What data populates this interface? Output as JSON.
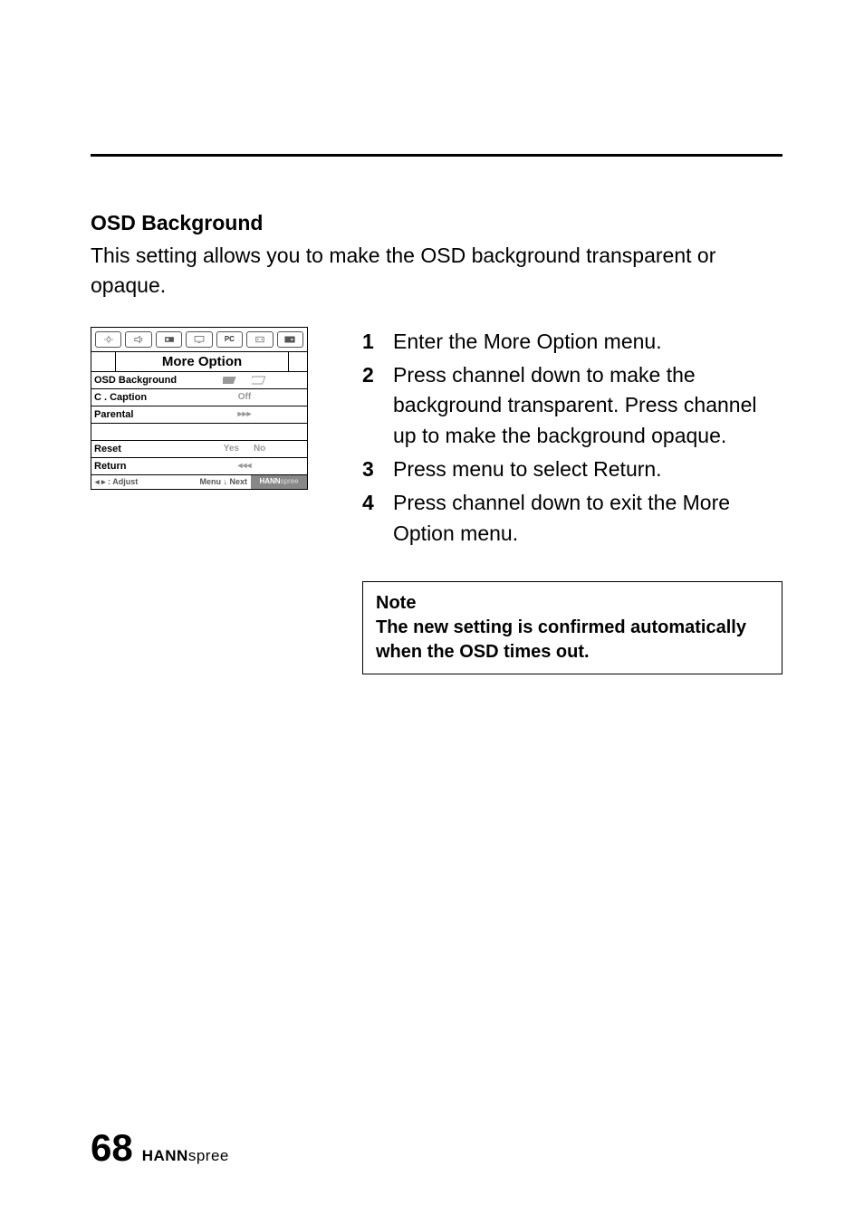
{
  "section": {
    "heading": "OSD Background",
    "intro": "This setting allows you to make the OSD background transparent or opaque."
  },
  "osd": {
    "tabs": [
      "brightness",
      "sound",
      "picture",
      "display",
      "pc",
      "setup",
      "more"
    ],
    "pc_label": "PC",
    "title": "More Option",
    "rows": {
      "bg_label": "OSD Background",
      "caption_label": "C . Caption",
      "caption_value": "Off",
      "parental_label": "Parental",
      "parental_value": "▸▸▸",
      "reset_label": "Reset",
      "reset_yes": "Yes",
      "reset_no": "No",
      "return_label": "Return",
      "return_value": "◂◂◂"
    },
    "footer": {
      "left": "◂ ▸ : Adjust",
      "mid": "Menu ↓ Next",
      "brand1": "HANN",
      "brand2": "spree"
    }
  },
  "steps": [
    "Enter the More Option menu.",
    "Press channel down to make the background transparent. Press channel up to make the background opaque.",
    "Press menu to select Return.",
    "Press channel down to exit the More Option menu."
  ],
  "note": {
    "title": "Note",
    "body": "The new setting is confirmed automatically when the OSD times out."
  },
  "pagefoot": {
    "number": "68",
    "brand1": "HANN",
    "brand2": "spree"
  }
}
